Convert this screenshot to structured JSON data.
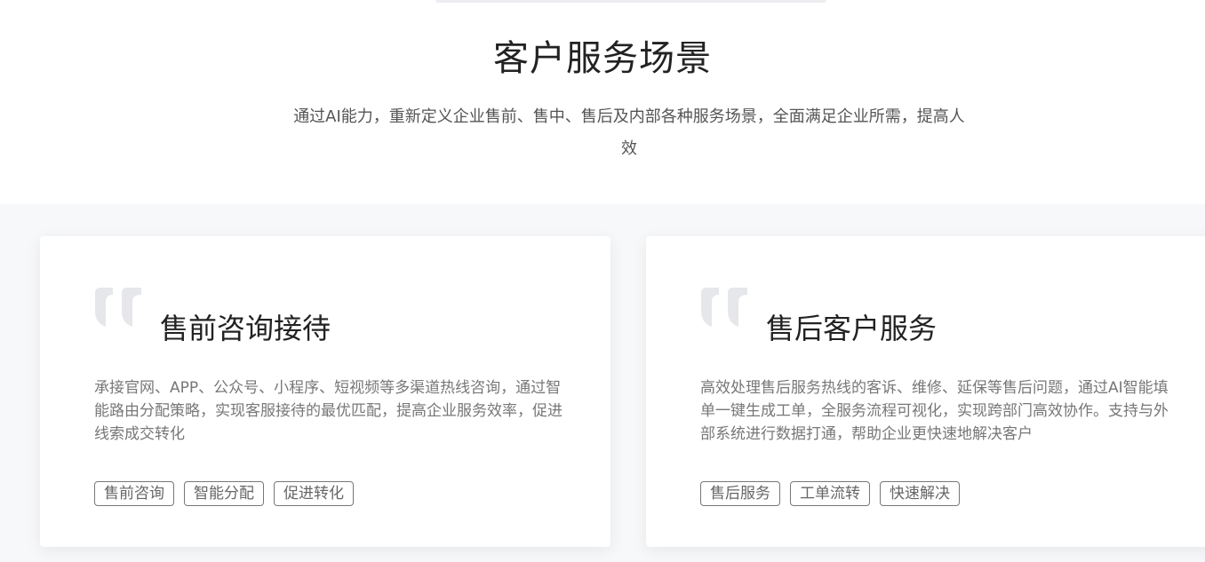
{
  "section": {
    "title": "客户服务场景",
    "subtitle": "通过AI能力，重新定义企业售前、售中、售后及内部各种服务场景，全面满足企业所需，提高人效"
  },
  "cards": [
    {
      "icon": "quote-icon",
      "title": "售前咨询接待",
      "description": "承接官网、APP、公众号、小程序、短视频等多渠道热线咨询，通过智能路由分配策略，实现客服接待的最优匹配，提高企业服务效率，促进线索成交转化",
      "tags": [
        "售前咨询",
        "智能分配",
        "促进转化"
      ]
    },
    {
      "icon": "quote-icon",
      "title": "售后客户服务",
      "description": "高效处理售后服务热线的客诉、维修、延保等售后问题，通过AI智能填单一键生成工单，全服务流程可视化，实现跨部门高效协作。支持与外部系统进行数据打通，帮助企业更快速地解决客户",
      "tags": [
        "售后服务",
        "工单流转",
        "快速解决"
      ]
    }
  ],
  "colors": {
    "background": "#f7f8fa",
    "card": "#ffffff",
    "quote_mark": "#e6e7ea",
    "title": "#222222",
    "text": "#777777",
    "tag_border": "#777777"
  }
}
